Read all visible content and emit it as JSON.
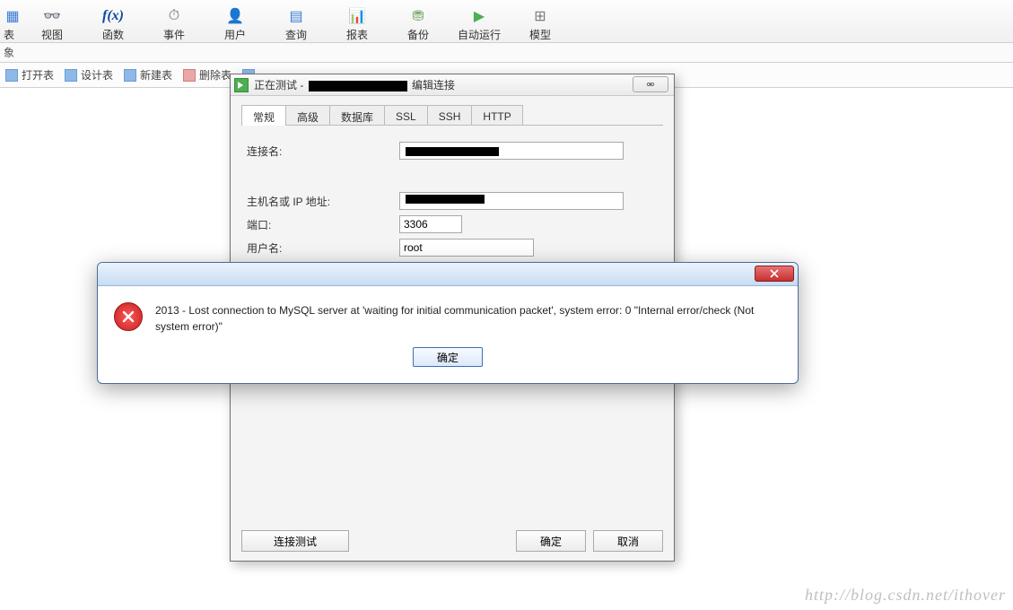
{
  "toolbar": {
    "items": [
      {
        "label": "表",
        "icon": "table-icon"
      },
      {
        "label": "视图",
        "icon": "view-icon"
      },
      {
        "label": "函数",
        "icon": "function-icon"
      },
      {
        "label": "事件",
        "icon": "event-icon"
      },
      {
        "label": "用户",
        "icon": "user-icon"
      },
      {
        "label": "查询",
        "icon": "query-icon"
      },
      {
        "label": "报表",
        "icon": "report-icon"
      },
      {
        "label": "备份",
        "icon": "backup-icon"
      },
      {
        "label": "自动运行",
        "icon": "autorun-icon"
      },
      {
        "label": "模型",
        "icon": "model-icon"
      }
    ]
  },
  "object_bar": {
    "label": "象"
  },
  "sub_toolbar": {
    "open": "打开表",
    "design": "设计表",
    "new": "新建表",
    "delete": "删除表"
  },
  "conn_dialog": {
    "title_prefix": "正在测试 -",
    "title_suffix": "编辑连接",
    "close_glyph": "⚮",
    "tabs": [
      "常规",
      "高级",
      "数据库",
      "SSL",
      "SSH",
      "HTTP"
    ],
    "fields": {
      "name_label": "连接名:",
      "host_label": "主机名或 IP 地址:",
      "port_label": "端口:",
      "port_value": "3306",
      "user_label": "用户名:",
      "user_value": "root"
    },
    "buttons": {
      "test": "连接测试",
      "ok": "确定",
      "cancel": "取消"
    }
  },
  "error_dialog": {
    "message": "2013 - Lost connection to MySQL server at 'waiting for initial communication packet', system error: 0 \"Internal error/check (Not system error)\"",
    "ok": "确定"
  },
  "watermark": "http://blog.csdn.net/ithover"
}
